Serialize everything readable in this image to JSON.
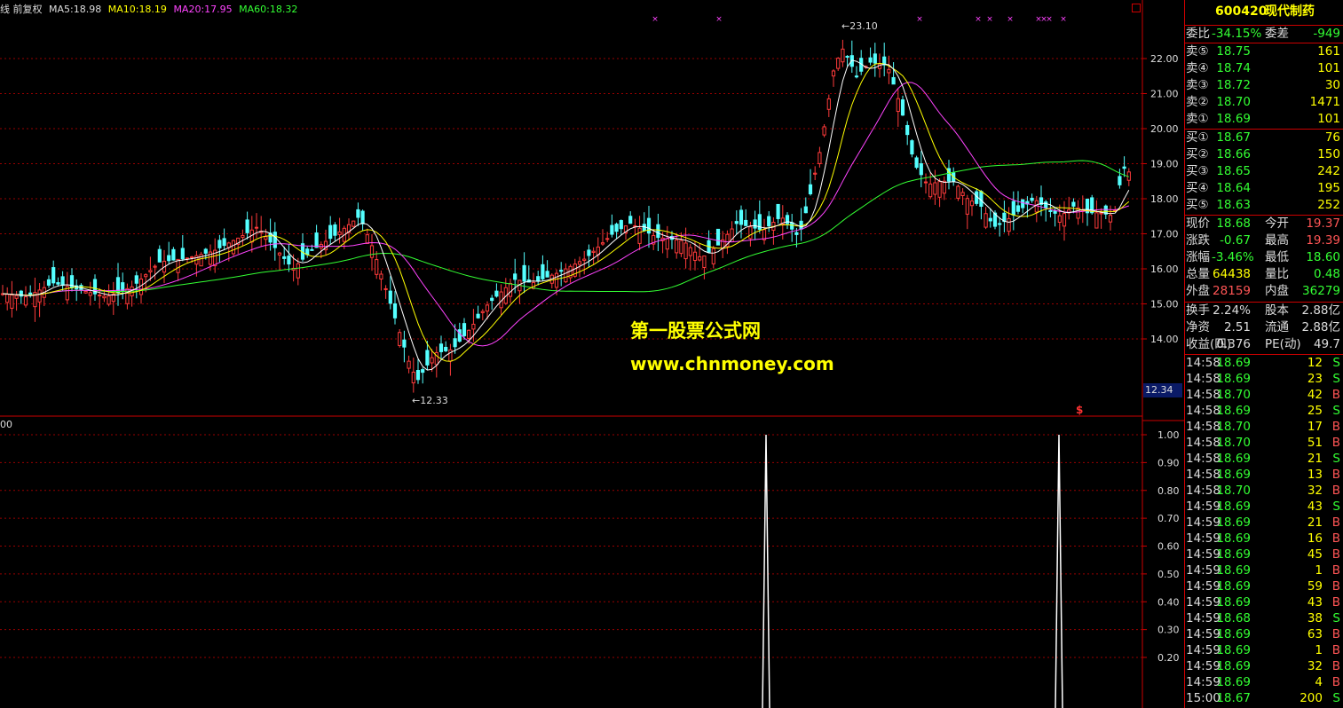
{
  "legend": {
    "title": "线 前复权",
    "ma5": "MA5:18.98",
    "ma10": "MA10:18.19",
    "ma20": "MA20:17.95",
    "ma60": "MA60:18.32"
  },
  "colors": {
    "up": "#ff3b3b",
    "down": "#54ffff",
    "ma5": "#ffffff",
    "ma10": "#ffff00",
    "ma20": "#ff44ff",
    "ma60": "#33ff33",
    "grid": "#990000"
  },
  "markers": {
    "high": "23.10",
    "low": "12.33",
    "last_price": "12.34",
    "indicator_top": "00",
    "signal_letter": "$"
  },
  "watermark": {
    "line1": "第一股票公式网",
    "line2": "www.chnmoney.com"
  },
  "price_axis": [
    "22.00",
    "21.00",
    "20.00",
    "19.00",
    "18.00",
    "17.00",
    "16.00",
    "15.00",
    "14.00"
  ],
  "indicator_axis": [
    "1.00",
    "0.90",
    "0.80",
    "0.70",
    "0.60",
    "0.50",
    "0.40",
    "0.30",
    "0.20"
  ],
  "chart_data": {
    "type": "candlestick",
    "series": [
      {
        "name": "MA5",
        "value": 18.98
      },
      {
        "name": "MA10",
        "value": 18.19
      },
      {
        "name": "MA20",
        "value": 17.95
      },
      {
        "name": "MA60",
        "value": 18.32
      }
    ],
    "high": 23.1,
    "low": 12.33,
    "ylim": [
      12.0,
      23.4
    ],
    "indicator": {
      "ylim": [
        0,
        1.0
      ],
      "spikes": [
        1.0,
        1.0
      ]
    }
  },
  "quote": {
    "code": "600420",
    "name": "现代制药",
    "weibi_label": "委比",
    "weibi": "-34.15%",
    "weicha_label": "委差",
    "weicha": "-949",
    "asks": [
      {
        "label": "卖⑤",
        "price": "18.75",
        "vol": "161"
      },
      {
        "label": "卖④",
        "price": "18.74",
        "vol": "101"
      },
      {
        "label": "卖③",
        "price": "18.72",
        "vol": "30"
      },
      {
        "label": "卖②",
        "price": "18.70",
        "vol": "1471"
      },
      {
        "label": "卖①",
        "price": "18.69",
        "vol": "101"
      }
    ],
    "bids": [
      {
        "label": "买①",
        "price": "18.67",
        "vol": "76"
      },
      {
        "label": "买②",
        "price": "18.66",
        "vol": "150"
      },
      {
        "label": "买③",
        "price": "18.65",
        "vol": "242"
      },
      {
        "label": "买④",
        "price": "18.64",
        "vol": "195"
      },
      {
        "label": "买⑤",
        "price": "18.63",
        "vol": "252"
      }
    ],
    "stats": [
      {
        "l1": "现价",
        "v1": "18.68",
        "c1": "grn",
        "l2": "今开",
        "v2": "19.37",
        "c2": "red"
      },
      {
        "l1": "涨跌",
        "v1": "-0.67",
        "c1": "grn",
        "l2": "最高",
        "v2": "19.39",
        "c2": "red"
      },
      {
        "l1": "涨幅",
        "v1": "-3.46%",
        "c1": "grn",
        "l2": "最低",
        "v2": "18.60",
        "c2": "grn"
      },
      {
        "l1": "总量",
        "v1": "64438",
        "c1": "yel",
        "l2": "量比",
        "v2": "0.48",
        "c2": "grn"
      },
      {
        "l1": "外盘",
        "v1": "28159",
        "c1": "red",
        "l2": "内盘",
        "v2": "36279",
        "c2": "grn"
      }
    ],
    "fundamentals": [
      {
        "l1": "换手",
        "v1": "2.24%",
        "l2": "股本",
        "v2": "2.88亿"
      },
      {
        "l1": "净资",
        "v1": "2.51",
        "l2": "流通",
        "v2": "2.88亿"
      },
      {
        "l1": "收益(四)",
        "v1": "0.376",
        "l2": "PE(动)",
        "v2": "49.7"
      }
    ],
    "ticks": [
      {
        "t": "14:58",
        "p": "18.69",
        "v": "12",
        "s": "S"
      },
      {
        "t": "14:58",
        "p": "18.69",
        "v": "23",
        "s": "S"
      },
      {
        "t": "14:58",
        "p": "18.70",
        "v": "42",
        "s": "B"
      },
      {
        "t": "14:58",
        "p": "18.69",
        "v": "25",
        "s": "S"
      },
      {
        "t": "14:58",
        "p": "18.70",
        "v": "17",
        "s": "B"
      },
      {
        "t": "14:58",
        "p": "18.70",
        "v": "51",
        "s": "B"
      },
      {
        "t": "14:58",
        "p": "18.69",
        "v": "21",
        "s": "S"
      },
      {
        "t": "14:58",
        "p": "18.69",
        "v": "13",
        "s": "B"
      },
      {
        "t": "14:58",
        "p": "18.70",
        "v": "32",
        "s": "B"
      },
      {
        "t": "14:59",
        "p": "18.69",
        "v": "43",
        "s": "S"
      },
      {
        "t": "14:59",
        "p": "18.69",
        "v": "21",
        "s": "B"
      },
      {
        "t": "14:59",
        "p": "18.69",
        "v": "16",
        "s": "B"
      },
      {
        "t": "14:59",
        "p": "18.69",
        "v": "45",
        "s": "B"
      },
      {
        "t": "14:59",
        "p": "18.69",
        "v": "1",
        "s": "B"
      },
      {
        "t": "14:59",
        "p": "18.69",
        "v": "59",
        "s": "B"
      },
      {
        "t": "14:59",
        "p": "18.69",
        "v": "43",
        "s": "B"
      },
      {
        "t": "14:59",
        "p": "18.68",
        "v": "38",
        "s": "S"
      },
      {
        "t": "14:59",
        "p": "18.69",
        "v": "63",
        "s": "B"
      },
      {
        "t": "14:59",
        "p": "18.69",
        "v": "1",
        "s": "B"
      },
      {
        "t": "14:59",
        "p": "18.69",
        "v": "32",
        "s": "B"
      },
      {
        "t": "14:59",
        "p": "18.69",
        "v": "4",
        "s": "B"
      },
      {
        "t": "15:00",
        "p": "18.67",
        "v": "200",
        "s": "S"
      }
    ]
  }
}
